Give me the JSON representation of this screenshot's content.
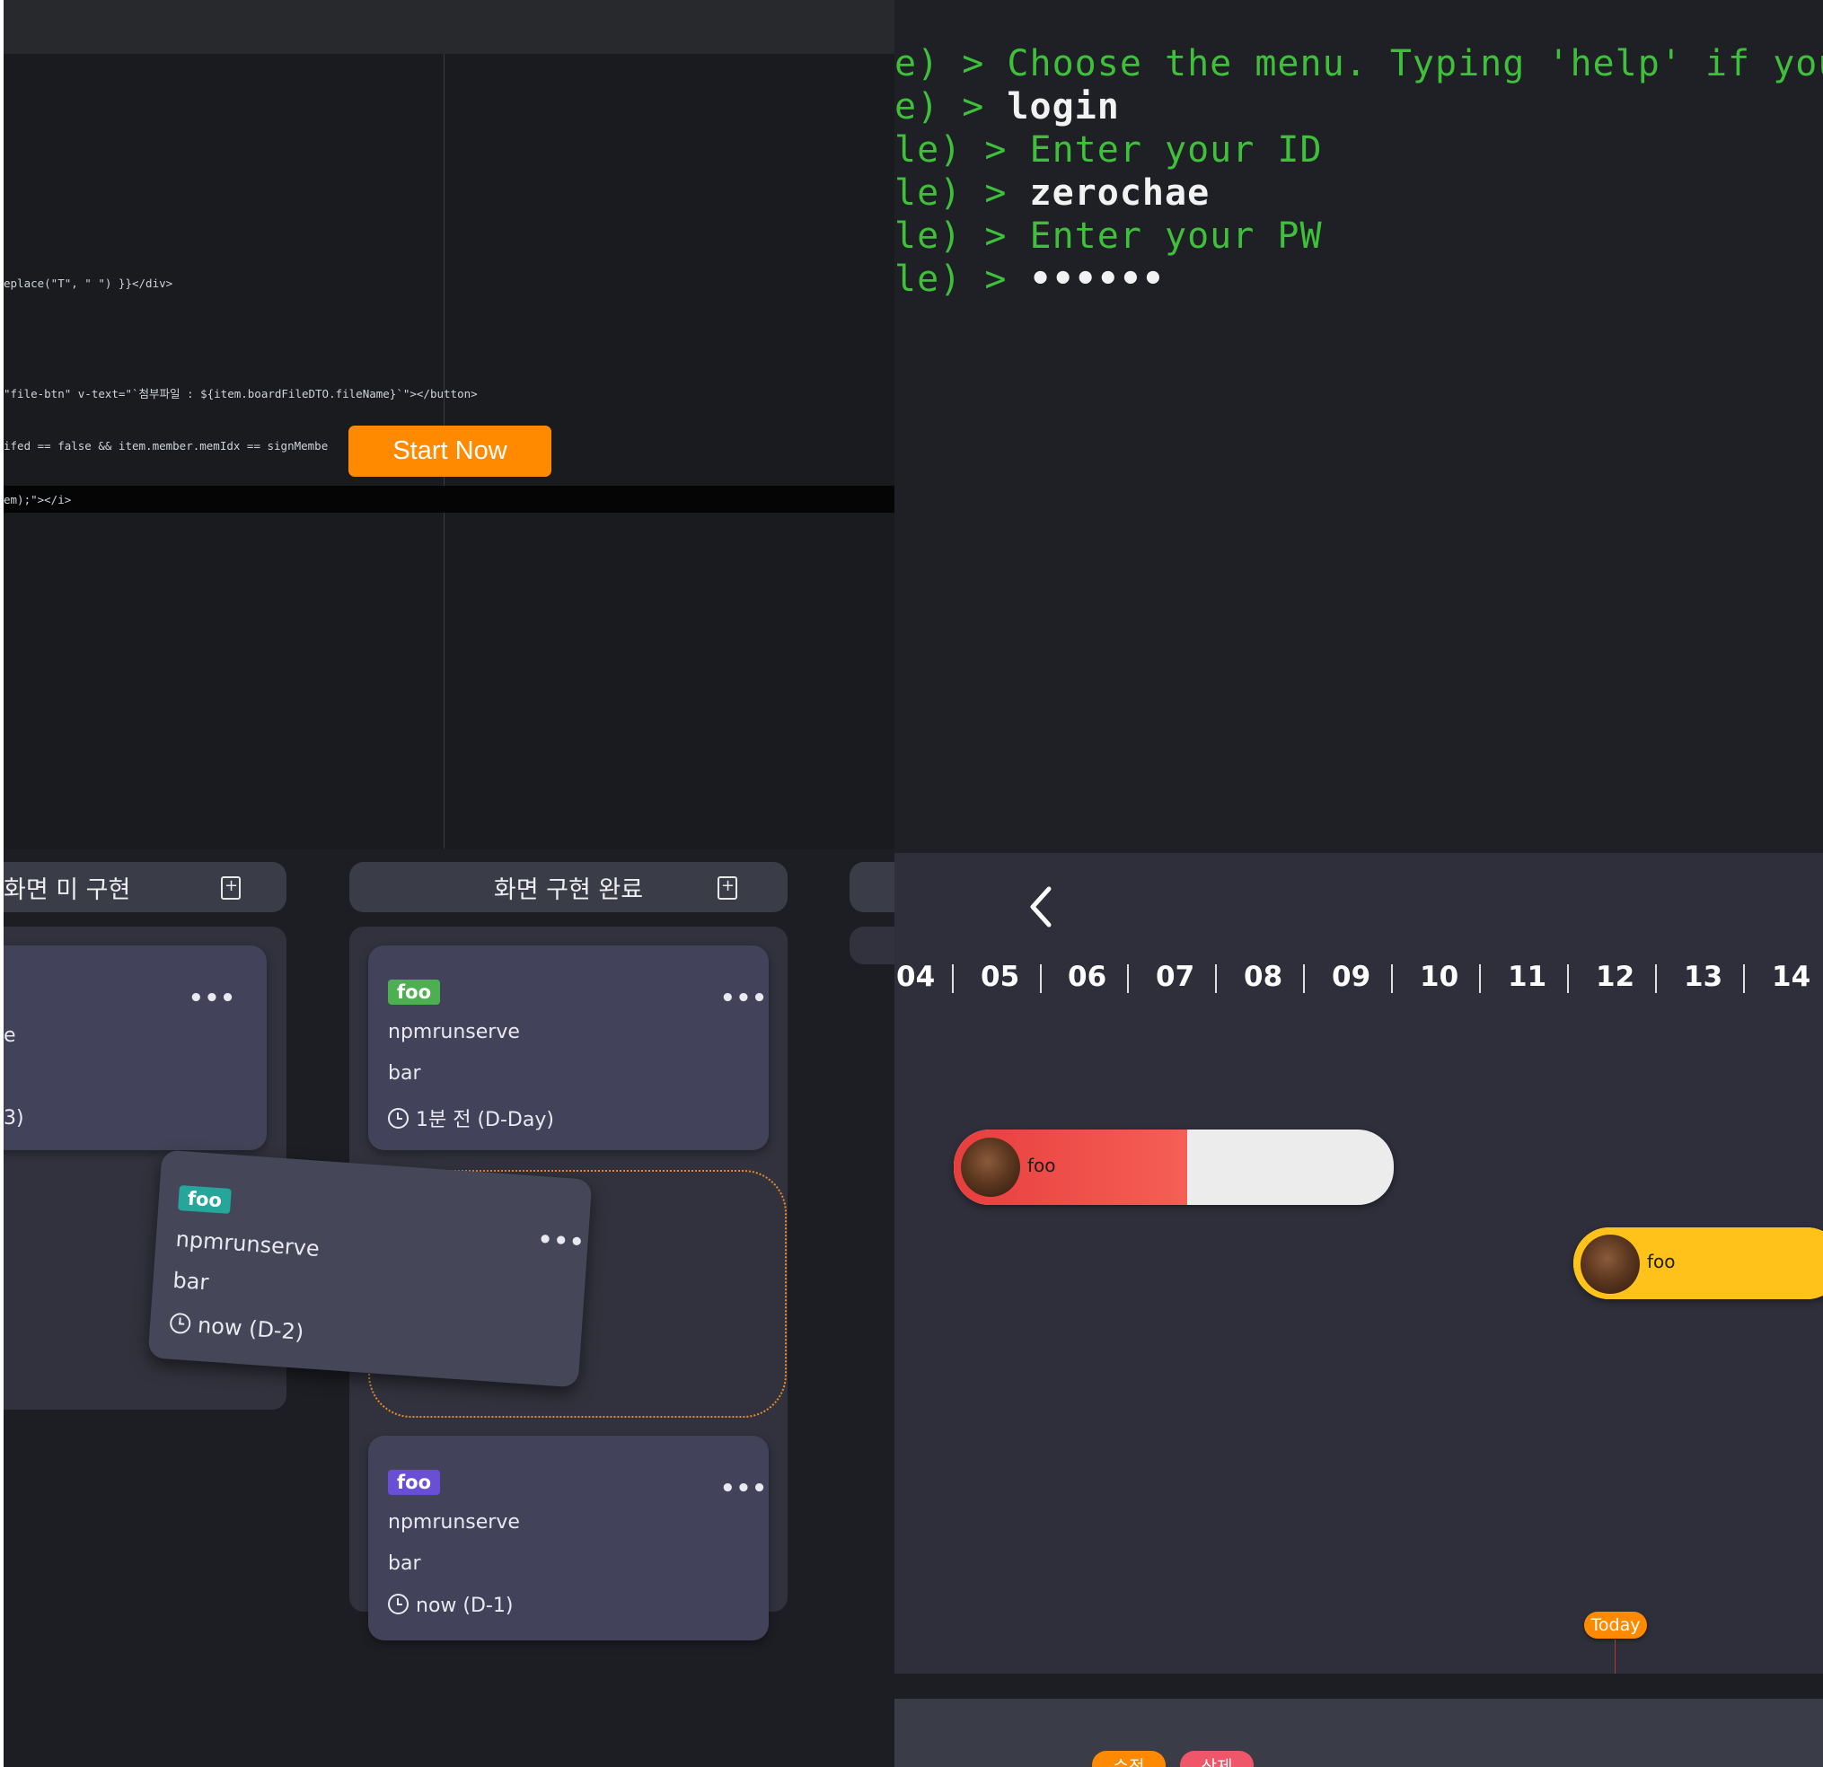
{
  "editor": {
    "code_lines": [
      {
        "text": "eplace(\"T\", \" \") }}</div>"
      },
      {
        "text": "\"file-btn\" v-text=\"`첨부파일 : ${item.boardFileDTO.fileName}`\"></button>"
      },
      {
        "text": "ifed == false && item.member.memIdx == signMembe"
      },
      {
        "text": "em);\"></i>"
      }
    ],
    "start_button": "Start Now"
  },
  "terminal": {
    "prompt": ") >",
    "lines": [
      {
        "prefix": "e)",
        "text": "Choose the menu. Typing 'help' if you w",
        "style": "green"
      },
      {
        "prefix": "e)",
        "text": "login",
        "style": "white"
      },
      {
        "prefix": "le)",
        "text": "Enter your ID",
        "style": "green"
      },
      {
        "prefix": "le)",
        "text": "zerochae",
        "style": "white"
      },
      {
        "prefix": "le)",
        "text": "Enter your PW",
        "style": "green"
      },
      {
        "prefix": "le)",
        "text": "••••••",
        "style": "white"
      }
    ]
  },
  "kanban": {
    "columns": [
      {
        "title": "화면 미 구현"
      },
      {
        "title": "화면 구현 완료"
      }
    ],
    "partial_card": {
      "line1": "e",
      "line2": "3)"
    },
    "cards": [
      {
        "badge": "foo",
        "badge_color": "#4caf50",
        "title": "npmrunserve",
        "desc": "bar",
        "due": "1분 전 (D-Day)"
      },
      {
        "badge": "foo",
        "badge_color": "#26a69a",
        "title": "npmrunserve",
        "desc": "bar",
        "due": "now (D-2)"
      },
      {
        "badge": "foo",
        "badge_color": "#6a4fd6",
        "title": "npmrunserve",
        "desc": "bar",
        "due": "now (D-1)"
      }
    ],
    "more_label": "•••"
  },
  "timeline": {
    "days": [
      "04",
      "05",
      "06",
      "07",
      "08",
      "09",
      "10",
      "11",
      "12",
      "13",
      "14"
    ],
    "bars": [
      {
        "label": "foo",
        "color": "#ee4444",
        "progress": 0.53
      },
      {
        "label": "foo",
        "color": "#ffc21a",
        "progress": 1.0
      }
    ],
    "today_label": "Today",
    "edit_label": "수정",
    "delete_label": "삭제",
    "colors": {
      "today": "#ff8a00",
      "edit": "#ff8a00",
      "delete": "#f0566a"
    }
  }
}
